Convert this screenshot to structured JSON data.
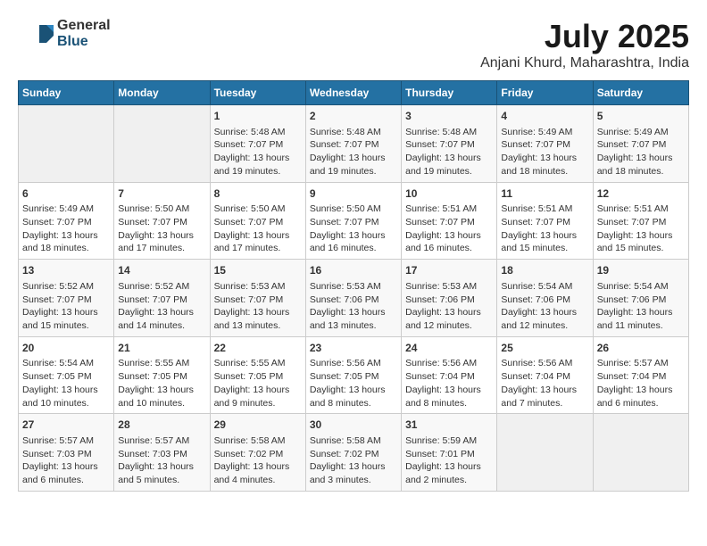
{
  "logo": {
    "line1": "General",
    "line2": "Blue"
  },
  "title": "July 2025",
  "location": "Anjani Khurd, Maharashtra, India",
  "headers": [
    "Sunday",
    "Monday",
    "Tuesday",
    "Wednesday",
    "Thursday",
    "Friday",
    "Saturday"
  ],
  "weeks": [
    [
      {
        "day": "",
        "content": ""
      },
      {
        "day": "",
        "content": ""
      },
      {
        "day": "1",
        "content": "Sunrise: 5:48 AM\nSunset: 7:07 PM\nDaylight: 13 hours and 19 minutes."
      },
      {
        "day": "2",
        "content": "Sunrise: 5:48 AM\nSunset: 7:07 PM\nDaylight: 13 hours and 19 minutes."
      },
      {
        "day": "3",
        "content": "Sunrise: 5:48 AM\nSunset: 7:07 PM\nDaylight: 13 hours and 19 minutes."
      },
      {
        "day": "4",
        "content": "Sunrise: 5:49 AM\nSunset: 7:07 PM\nDaylight: 13 hours and 18 minutes."
      },
      {
        "day": "5",
        "content": "Sunrise: 5:49 AM\nSunset: 7:07 PM\nDaylight: 13 hours and 18 minutes."
      }
    ],
    [
      {
        "day": "6",
        "content": "Sunrise: 5:49 AM\nSunset: 7:07 PM\nDaylight: 13 hours and 18 minutes."
      },
      {
        "day": "7",
        "content": "Sunrise: 5:50 AM\nSunset: 7:07 PM\nDaylight: 13 hours and 17 minutes."
      },
      {
        "day": "8",
        "content": "Sunrise: 5:50 AM\nSunset: 7:07 PM\nDaylight: 13 hours and 17 minutes."
      },
      {
        "day": "9",
        "content": "Sunrise: 5:50 AM\nSunset: 7:07 PM\nDaylight: 13 hours and 16 minutes."
      },
      {
        "day": "10",
        "content": "Sunrise: 5:51 AM\nSunset: 7:07 PM\nDaylight: 13 hours and 16 minutes."
      },
      {
        "day": "11",
        "content": "Sunrise: 5:51 AM\nSunset: 7:07 PM\nDaylight: 13 hours and 15 minutes."
      },
      {
        "day": "12",
        "content": "Sunrise: 5:51 AM\nSunset: 7:07 PM\nDaylight: 13 hours and 15 minutes."
      }
    ],
    [
      {
        "day": "13",
        "content": "Sunrise: 5:52 AM\nSunset: 7:07 PM\nDaylight: 13 hours and 15 minutes."
      },
      {
        "day": "14",
        "content": "Sunrise: 5:52 AM\nSunset: 7:07 PM\nDaylight: 13 hours and 14 minutes."
      },
      {
        "day": "15",
        "content": "Sunrise: 5:53 AM\nSunset: 7:07 PM\nDaylight: 13 hours and 13 minutes."
      },
      {
        "day": "16",
        "content": "Sunrise: 5:53 AM\nSunset: 7:06 PM\nDaylight: 13 hours and 13 minutes."
      },
      {
        "day": "17",
        "content": "Sunrise: 5:53 AM\nSunset: 7:06 PM\nDaylight: 13 hours and 12 minutes."
      },
      {
        "day": "18",
        "content": "Sunrise: 5:54 AM\nSunset: 7:06 PM\nDaylight: 13 hours and 12 minutes."
      },
      {
        "day": "19",
        "content": "Sunrise: 5:54 AM\nSunset: 7:06 PM\nDaylight: 13 hours and 11 minutes."
      }
    ],
    [
      {
        "day": "20",
        "content": "Sunrise: 5:54 AM\nSunset: 7:05 PM\nDaylight: 13 hours and 10 minutes."
      },
      {
        "day": "21",
        "content": "Sunrise: 5:55 AM\nSunset: 7:05 PM\nDaylight: 13 hours and 10 minutes."
      },
      {
        "day": "22",
        "content": "Sunrise: 5:55 AM\nSunset: 7:05 PM\nDaylight: 13 hours and 9 minutes."
      },
      {
        "day": "23",
        "content": "Sunrise: 5:56 AM\nSunset: 7:05 PM\nDaylight: 13 hours and 8 minutes."
      },
      {
        "day": "24",
        "content": "Sunrise: 5:56 AM\nSunset: 7:04 PM\nDaylight: 13 hours and 8 minutes."
      },
      {
        "day": "25",
        "content": "Sunrise: 5:56 AM\nSunset: 7:04 PM\nDaylight: 13 hours and 7 minutes."
      },
      {
        "day": "26",
        "content": "Sunrise: 5:57 AM\nSunset: 7:04 PM\nDaylight: 13 hours and 6 minutes."
      }
    ],
    [
      {
        "day": "27",
        "content": "Sunrise: 5:57 AM\nSunset: 7:03 PM\nDaylight: 13 hours and 6 minutes."
      },
      {
        "day": "28",
        "content": "Sunrise: 5:57 AM\nSunset: 7:03 PM\nDaylight: 13 hours and 5 minutes."
      },
      {
        "day": "29",
        "content": "Sunrise: 5:58 AM\nSunset: 7:02 PM\nDaylight: 13 hours and 4 minutes."
      },
      {
        "day": "30",
        "content": "Sunrise: 5:58 AM\nSunset: 7:02 PM\nDaylight: 13 hours and 3 minutes."
      },
      {
        "day": "31",
        "content": "Sunrise: 5:59 AM\nSunset: 7:01 PM\nDaylight: 13 hours and 2 minutes."
      },
      {
        "day": "",
        "content": ""
      },
      {
        "day": "",
        "content": ""
      }
    ]
  ]
}
